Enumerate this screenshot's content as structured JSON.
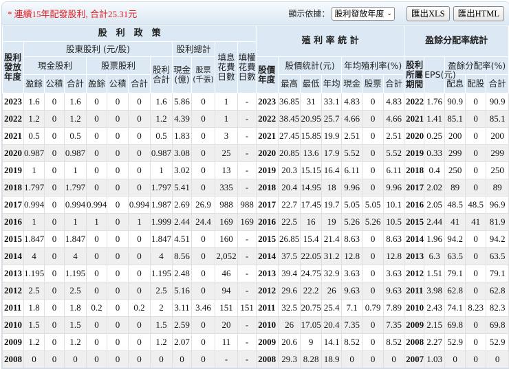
{
  "topbar": {
    "note": "連續15年配發股利, 合計25.31元",
    "note_prefix": "*",
    "display_label": "顯示依據：",
    "display_select": "股利發放年度",
    "export_xls": "匯出XLS",
    "export_html": "匯出HTML"
  },
  "headers": {
    "dividend_policy": "股　利　政　策",
    "yield_stats": "殖 利 率 統 計",
    "payout_stats": "盈餘分配率統計",
    "pay_year": "股利發放年度",
    "shareholder_div": "股東股利 (元/股)",
    "div_total_group": "股利總計",
    "fill_div_days": "填息花費日數",
    "fill_right_days": "填權花費日數",
    "cash_div": "現金股利",
    "stock_div": "股票股利",
    "div_sum": "股利合計",
    "cash_100m": "現金(億)",
    "stock_k": "股票(千張)",
    "earnings": "盈餘",
    "reserve": "公積",
    "subtotal": "合計",
    "price_year": "股價年度",
    "price_stats": "股價統計(元)",
    "avg_yield": "年均殖利率(%)",
    "div_period": "股利所屬期間",
    "eps": "EPS(元)",
    "payout_ratio": "盈餘分配率(%)",
    "high": "最高",
    "low": "最低",
    "avg": "年均",
    "cash": "現金",
    "stock": "股票",
    "total": "合計",
    "pay_cash": "配息",
    "pay_stock": "配股"
  },
  "rows": [
    [
      "2023",
      "1.6",
      "0",
      "1.6",
      "0",
      "0",
      "0",
      "1.6",
      "5.86",
      "0",
      "1",
      "-",
      "2023",
      "36.85",
      "31",
      "33.1",
      "4.83",
      "0",
      "4.83",
      "2022",
      "1.76",
      "90.9",
      "0",
      "90.9"
    ],
    [
      "2022",
      "1.2",
      "0",
      "1.2",
      "0",
      "0",
      "0",
      "1.2",
      "4.39",
      "0",
      "1",
      "-",
      "2022",
      "38.45",
      "20.95",
      "25.7",
      "4.66",
      "0",
      "4.66",
      "2021",
      "1.41",
      "85.1",
      "0",
      "85.1"
    ],
    [
      "2021",
      "0.5",
      "0",
      "0.5",
      "0",
      "0",
      "0",
      "0.5",
      "1.83",
      "0",
      "3",
      "-",
      "2021",
      "27.45",
      "15.85",
      "19.9",
      "2.51",
      "0",
      "2.51",
      "2020",
      "0.25",
      "200",
      "0",
      "200"
    ],
    [
      "2020",
      "0.987",
      "0",
      "0.987",
      "0",
      "0",
      "0",
      "0.987",
      "3.08",
      "0",
      "25",
      "-",
      "2020",
      "20.85",
      "13.6",
      "17.9",
      "5.52",
      "0",
      "5.52",
      "2019",
      "0.33",
      "299",
      "0",
      "299"
    ],
    [
      "2019",
      "1",
      "0",
      "1",
      "0",
      "0",
      "0",
      "1",
      "3.02",
      "0",
      "13",
      "-",
      "2019",
      "20.3",
      "15.15",
      "16.4",
      "6.11",
      "0",
      "6.11",
      "2018",
      "0.4",
      "250",
      "0",
      "250"
    ],
    [
      "2018",
      "1.797",
      "0",
      "1.797",
      "0",
      "0",
      "0",
      "1.797",
      "5.41",
      "0",
      "335",
      "-",
      "2018",
      "20.4",
      "14.95",
      "18",
      "9.96",
      "0",
      "9.96",
      "2017",
      "2.02",
      "89",
      "0",
      "89"
    ],
    [
      "2017",
      "0.994",
      "0",
      "0.994",
      "0.994",
      "0",
      "0.994",
      "1.987",
      "2.69",
      "26.9",
      "988",
      "988",
      "2017",
      "22.7",
      "17.45",
      "19.7",
      "5.05",
      "5.05",
      "10.1",
      "2016",
      "2.05",
      "48.5",
      "48.5",
      "96.9"
    ],
    [
      "2016",
      "1",
      "0",
      "1",
      "1",
      "0",
      "1",
      "1.999",
      "2.44",
      "24.4",
      "169",
      "169",
      "2016",
      "22.5",
      "16",
      "19",
      "5.26",
      "5.26",
      "10.5",
      "2015",
      "2.44",
      "41",
      "41",
      "81.9"
    ],
    [
      "2015",
      "1.847",
      "0",
      "1.847",
      "0",
      "0",
      "0",
      "1.847",
      "4.51",
      "0",
      "160",
      "-",
      "2015",
      "26.85",
      "15.4",
      "21.4",
      "8.63",
      "0",
      "8.63",
      "2014",
      "1.96",
      "94.2",
      "0",
      "94.2"
    ],
    [
      "2014",
      "4",
      "0",
      "4",
      "0",
      "0",
      "0",
      "4",
      "8.56",
      "0",
      "2,052",
      "-",
      "2014",
      "37.5",
      "22.05",
      "31.2",
      "12.8",
      "0",
      "12.8",
      "2013",
      "6.3",
      "63.5",
      "0",
      "63.5"
    ],
    [
      "2013",
      "1.195",
      "0",
      "1.195",
      "0",
      "0",
      "0",
      "1.195",
      "2.48",
      "0",
      "46",
      "-",
      "2013",
      "39.4",
      "24.75",
      "32.9",
      "3.63",
      "0",
      "3.63",
      "2012",
      "1.51",
      "79.1",
      "0",
      "79.1"
    ],
    [
      "2012",
      "2.5",
      "0",
      "2.5",
      "0",
      "0",
      "0",
      "2.5",
      "5.16",
      "0",
      "94",
      "-",
      "2012",
      "29.6",
      "22.2",
      "26",
      "9.63",
      "0",
      "9.63",
      "2011",
      "3.98",
      "62.8",
      "0",
      "62.8"
    ],
    [
      "2011",
      "1.8",
      "0",
      "1.8",
      "0.2",
      "0",
      "0.2",
      "2",
      "3.11",
      "3.46",
      "151",
      "151",
      "2011",
      "32.5",
      "20.75",
      "25.4",
      "7.1",
      "0.79",
      "7.89",
      "2010",
      "2.43",
      "74.1",
      "8.23",
      "82.3"
    ],
    [
      "2010",
      "1.5",
      "0",
      "1.5",
      "0",
      "0",
      "0",
      "1.5",
      "2.59",
      "0",
      "20",
      "-",
      "2010",
      "26",
      "17.05",
      "20.4",
      "7.35",
      "0",
      "7.35",
      "2009",
      "2.15",
      "69.8",
      "0",
      "69.8"
    ],
    [
      "2009",
      "1.2",
      "0",
      "1.2",
      "0",
      "0",
      "0",
      "1.2",
      "2.07",
      "0",
      "11",
      "-",
      "2009",
      "20.6",
      "9",
      "14.1",
      "8.52",
      "0",
      "8.52",
      "2008",
      "2.27",
      "52.9",
      "0",
      "52.9"
    ],
    [
      "2008",
      "0",
      "0",
      "0",
      "0",
      "0",
      "0",
      "0",
      "0",
      "0",
      "-",
      "-",
      "2008",
      "29.3",
      "8.28",
      "18.9",
      "0",
      "0",
      "0",
      "2007",
      "1.03",
      "0",
      "0",
      "0"
    ]
  ],
  "colors": {
    "note": "#e02020",
    "header_bg": "#dce9f5",
    "row_alt": "#efefef"
  }
}
